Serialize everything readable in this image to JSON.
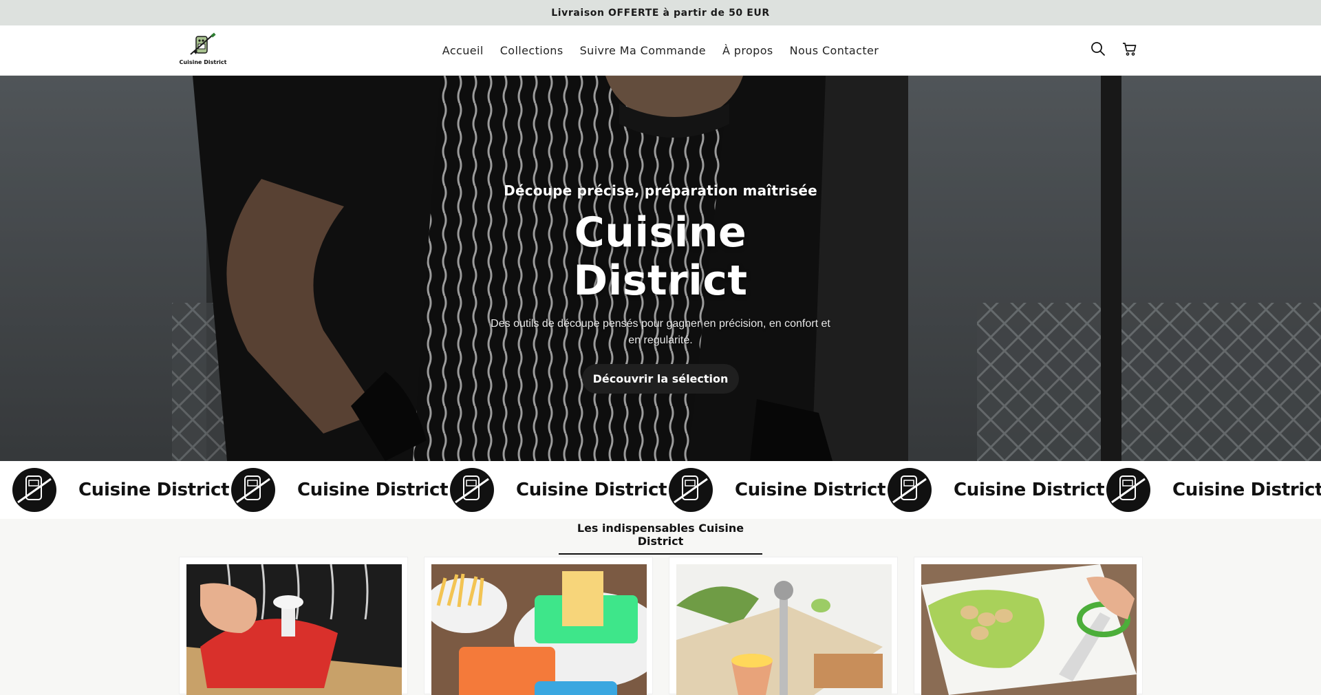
{
  "announcement": {
    "text": "Livraison OFFERTE à partir de 50 EUR"
  },
  "header": {
    "logo_text": "Cuisine District",
    "nav": [
      {
        "label": "Accueil"
      },
      {
        "label": "Collections"
      },
      {
        "label": "Suivre Ma Commande"
      },
      {
        "label": "À propos"
      },
      {
        "label": "Nous Contacter"
      }
    ],
    "icons": {
      "search": "search-icon",
      "cart": "cart-icon"
    }
  },
  "hero": {
    "subtitle": "Découpe précise, préparation maîtrisée",
    "title": "Cuisine District",
    "description": "Des outils de découpe pensés pour gagner en précision, en confort et en regularité.",
    "button_label": "Découvrir la sélection"
  },
  "marquee": {
    "items": [
      {
        "text": "Cuisine District"
      },
      {
        "text": "Cuisine District"
      },
      {
        "text": "Cuisine District"
      },
      {
        "text": "Cuisine District"
      },
      {
        "text": "Cuisine District"
      },
      {
        "text": "Cuisine District"
      }
    ]
  },
  "collection": {
    "title": "Les indispensables Cuisine District",
    "products": [
      {
        "image": "red-onion-chopper-photo"
      },
      {
        "image": "french-fry-cutter-photo"
      },
      {
        "image": "egg-topper-photo"
      },
      {
        "image": "quail-egg-scissors-photo"
      }
    ]
  },
  "colors": {
    "announcement_bg": "#dde1de",
    "button_bg": "#1f1f1f",
    "page_bg": "#f7f7f5"
  }
}
